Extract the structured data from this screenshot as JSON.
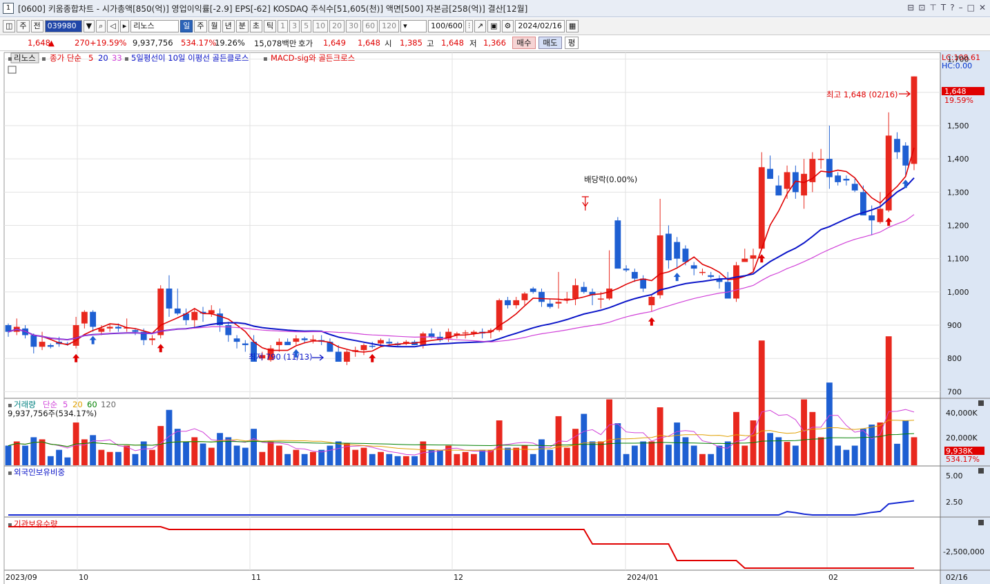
{
  "window": {
    "number": "1",
    "title": "[0600] 키움종합차트 - 시가총액[850(억)] 영업이익률[-2.9] EPS[-62] KOSDAQ 주식수[51,605(천)] 액면[500] 자본금[258(억)] 결산[12월]"
  },
  "toolbar": {
    "type1": "주",
    "type2": "전",
    "code": "039980",
    "name": "리노스",
    "periods": [
      "일",
      "주",
      "월",
      "년",
      "분",
      "초",
      "틱"
    ],
    "intervals": [
      "1",
      "3",
      "5",
      "10",
      "20",
      "30",
      "60",
      "120"
    ],
    "count": "100/600",
    "date": "2024/02/16"
  },
  "quote": {
    "price": "1,648",
    "change": "270",
    "rate": "+19.59%",
    "volume": "9,937,756",
    "vol_rate": "534.17%",
    "turnover": "19.26%",
    "amount": "15,078백만",
    "hoga_label": "호가",
    "ask": "1,649",
    "bid": "1,648",
    "open_label": "시",
    "open": "1,385",
    "high_label": "고",
    "high": "1,648",
    "low_label": "저",
    "low": "1,366",
    "buy": "매수",
    "sell": "매도",
    "eq": "평"
  },
  "legend": {
    "name": "리노스",
    "ma": "종가 단순",
    "ma5": "5",
    "ma20": "20",
    "ma33": "33",
    "signal1": "5일평선이 10일 이평선 골든클로스",
    "signal2": "MACD-sig와 골든크로스"
  },
  "price_panel": {
    "lc": "LC:108.61",
    "hc": "HC:0.00",
    "yticks": [
      "1,700",
      "1,600",
      "1,500",
      "1,400",
      "1,300",
      "1,200",
      "1,100",
      "1,000",
      "900",
      "800",
      "700"
    ],
    "last_price_label": "1,648",
    "last_rate_label": "19.59%",
    "high_note": "최고 1,648 (02/16)",
    "low_note": "최저 790 (11/13)",
    "dividend_note": "배당락(0.00%)"
  },
  "volume_panel": {
    "title": "거래량",
    "ma": "단순",
    "ma5": "5",
    "ma20": "20",
    "ma60": "60",
    "ma120": "120",
    "value": "9,937,756주(534.17%)",
    "yticks": [
      "40,000K",
      "20,000K"
    ],
    "last_label": "9,938K",
    "last_rate": "534.17%"
  },
  "foreign_panel": {
    "title": "외국인보유비중",
    "yticks": [
      "5.00",
      "2.50"
    ]
  },
  "inst_panel": {
    "title": "기관보유수량",
    "yticks": [
      "-2,500,000"
    ]
  },
  "xaxis": {
    "labels": [
      "2023/09",
      "10",
      "11",
      "12",
      "2024/01",
      "02",
      "02/16"
    ]
  },
  "colors": {
    "up": "#e8281e",
    "down": "#1e5fd2",
    "ma5": "#e00000",
    "ma20": "#0a14c8",
    "ma33": "#d040d8",
    "foreign": "#1428d2",
    "inst": "#e00000",
    "grid": "#e2e2e2"
  },
  "chart_data": {
    "type": "candlestick",
    "ohlc": [
      [
        900,
        905,
        865,
        880
      ],
      [
        880,
        920,
        870,
        895
      ],
      [
        890,
        900,
        860,
        870
      ],
      [
        870,
        875,
        815,
        835
      ],
      [
        835,
        880,
        825,
        850
      ],
      [
        840,
        845,
        830,
        835
      ],
      [
        850,
        865,
        835,
        843
      ],
      [
        845,
        850,
        838,
        842
      ],
      [
        838,
        925,
        830,
        900
      ],
      [
        905,
        945,
        890,
        940
      ],
      [
        940,
        945,
        880,
        895
      ],
      [
        880,
        900,
        870,
        890
      ],
      [
        890,
        905,
        880,
        895
      ],
      [
        895,
        905,
        880,
        890
      ],
      [
        890,
        920,
        880,
        893
      ],
      [
        885,
        890,
        870,
        880
      ],
      [
        880,
        890,
        840,
        855
      ],
      [
        855,
        870,
        840,
        860
      ],
      [
        870,
        1020,
        860,
        1010
      ],
      [
        1010,
        1050,
        925,
        950
      ],
      [
        950,
        1010,
        930,
        935
      ],
      [
        935,
        950,
        900,
        915
      ],
      [
        915,
        950,
        890,
        940
      ],
      [
        940,
        955,
        910,
        935
      ],
      [
        935,
        960,
        925,
        945
      ],
      [
        935,
        950,
        880,
        900
      ],
      [
        900,
        910,
        850,
        870
      ],
      [
        860,
        870,
        830,
        850
      ],
      [
        845,
        855,
        820,
        840
      ],
      [
        850,
        870,
        790,
        790
      ],
      [
        800,
        820,
        795,
        810
      ],
      [
        795,
        840,
        790,
        830
      ],
      [
        840,
        860,
        820,
        850
      ],
      [
        850,
        860,
        840,
        840
      ],
      [
        850,
        870,
        840,
        860
      ],
      [
        860,
        865,
        845,
        855
      ],
      [
        855,
        870,
        845,
        857
      ],
      [
        855,
        870,
        840,
        850
      ],
      [
        850,
        860,
        820,
        820
      ],
      [
        820,
        840,
        790,
        790
      ],
      [
        790,
        825,
        780,
        820
      ],
      [
        820,
        835,
        805,
        825
      ],
      [
        825,
        845,
        810,
        840
      ],
      [
        838,
        850,
        830,
        836
      ],
      [
        845,
        860,
        835,
        855
      ],
      [
        850,
        860,
        840,
        845
      ],
      [
        845,
        850,
        835,
        840
      ],
      [
        845,
        855,
        840,
        850
      ],
      [
        850,
        855,
        840,
        840
      ],
      [
        840,
        880,
        830,
        875
      ],
      [
        875,
        890,
        860,
        865
      ],
      [
        865,
        880,
        850,
        855
      ],
      [
        860,
        890,
        850,
        880
      ],
      [
        870,
        880,
        860,
        875
      ],
      [
        875,
        885,
        860,
        878
      ],
      [
        875,
        885,
        865,
        880
      ],
      [
        880,
        890,
        860,
        875
      ],
      [
        880,
        890,
        860,
        885
      ],
      [
        885,
        980,
        880,
        975
      ],
      [
        975,
        985,
        950,
        960
      ],
      [
        960,
        985,
        950,
        975
      ],
      [
        975,
        1000,
        960,
        995
      ],
      [
        1010,
        1015,
        995,
        1000
      ],
      [
        1000,
        1010,
        955,
        970
      ],
      [
        965,
        980,
        950,
        955
      ],
      [
        965,
        1060,
        950,
        970
      ],
      [
        975,
        1000,
        965,
        980
      ],
      [
        980,
        1040,
        960,
        1020
      ],
      [
        1015,
        1030,
        995,
        1000
      ],
      [
        1000,
        1010,
        960,
        990
      ],
      [
        980,
        1000,
        950,
        980
      ],
      [
        980,
        1125,
        975,
        1010
      ],
      [
        1215,
        1225,
        1080,
        1070
      ],
      [
        1070,
        1080,
        1060,
        1065
      ],
      [
        1060,
        1070,
        1030,
        1040
      ],
      [
        1040,
        1050,
        1000,
        1010
      ],
      [
        960,
        990,
        940,
        985
      ],
      [
        990,
        1280,
        980,
        1170
      ],
      [
        1175,
        1200,
        1070,
        1095
      ],
      [
        1150,
        1165,
        1070,
        1100
      ],
      [
        1130,
        1140,
        1080,
        1090
      ],
      [
        1080,
        1090,
        1050,
        1070
      ],
      [
        1060,
        1070,
        1050,
        1060
      ],
      [
        1050,
        1060,
        1040,
        1045
      ],
      [
        1040,
        1050,
        1010,
        1030
      ],
      [
        1030,
        1060,
        1010,
        980
      ],
      [
        980,
        1090,
        970,
        1080
      ],
      [
        1090,
        1130,
        1090,
        1100
      ],
      [
        1100,
        1130,
        1060,
        1110
      ],
      [
        1130,
        1420,
        1130,
        1375
      ],
      [
        1370,
        1410,
        1340,
        1340
      ],
      [
        1320,
        1350,
        1290,
        1290
      ],
      [
        1310,
        1380,
        1280,
        1360
      ],
      [
        1360,
        1380,
        1280,
        1300
      ],
      [
        1290,
        1400,
        1250,
        1355
      ],
      [
        1330,
        1420,
        1300,
        1400
      ],
      [
        1400,
        1430,
        1370,
        1400
      ],
      [
        1400,
        1500,
        1310,
        1345
      ],
      [
        1350,
        1360,
        1320,
        1330
      ],
      [
        1340,
        1350,
        1320,
        1335
      ],
      [
        1325,
        1340,
        1300,
        1305
      ],
      [
        1300,
        1320,
        1240,
        1230
      ],
      [
        1230,
        1260,
        1170,
        1215
      ],
      [
        1210,
        1300,
        1205,
        1250
      ],
      [
        1245,
        1540,
        1240,
        1470
      ],
      [
        1460,
        1480,
        1400,
        1420
      ],
      [
        1440,
        1450,
        1350,
        1380
      ],
      [
        1385,
        1648,
        1366,
        1648
      ]
    ],
    "dividend_date": "2023/12",
    "high": {
      "value": 1648,
      "date": "02/16"
    },
    "low": {
      "value": 790,
      "date": "11/13"
    },
    "ylim": [
      680,
      1720
    ],
    "series_names": [
      "5",
      "20",
      "33"
    ]
  }
}
